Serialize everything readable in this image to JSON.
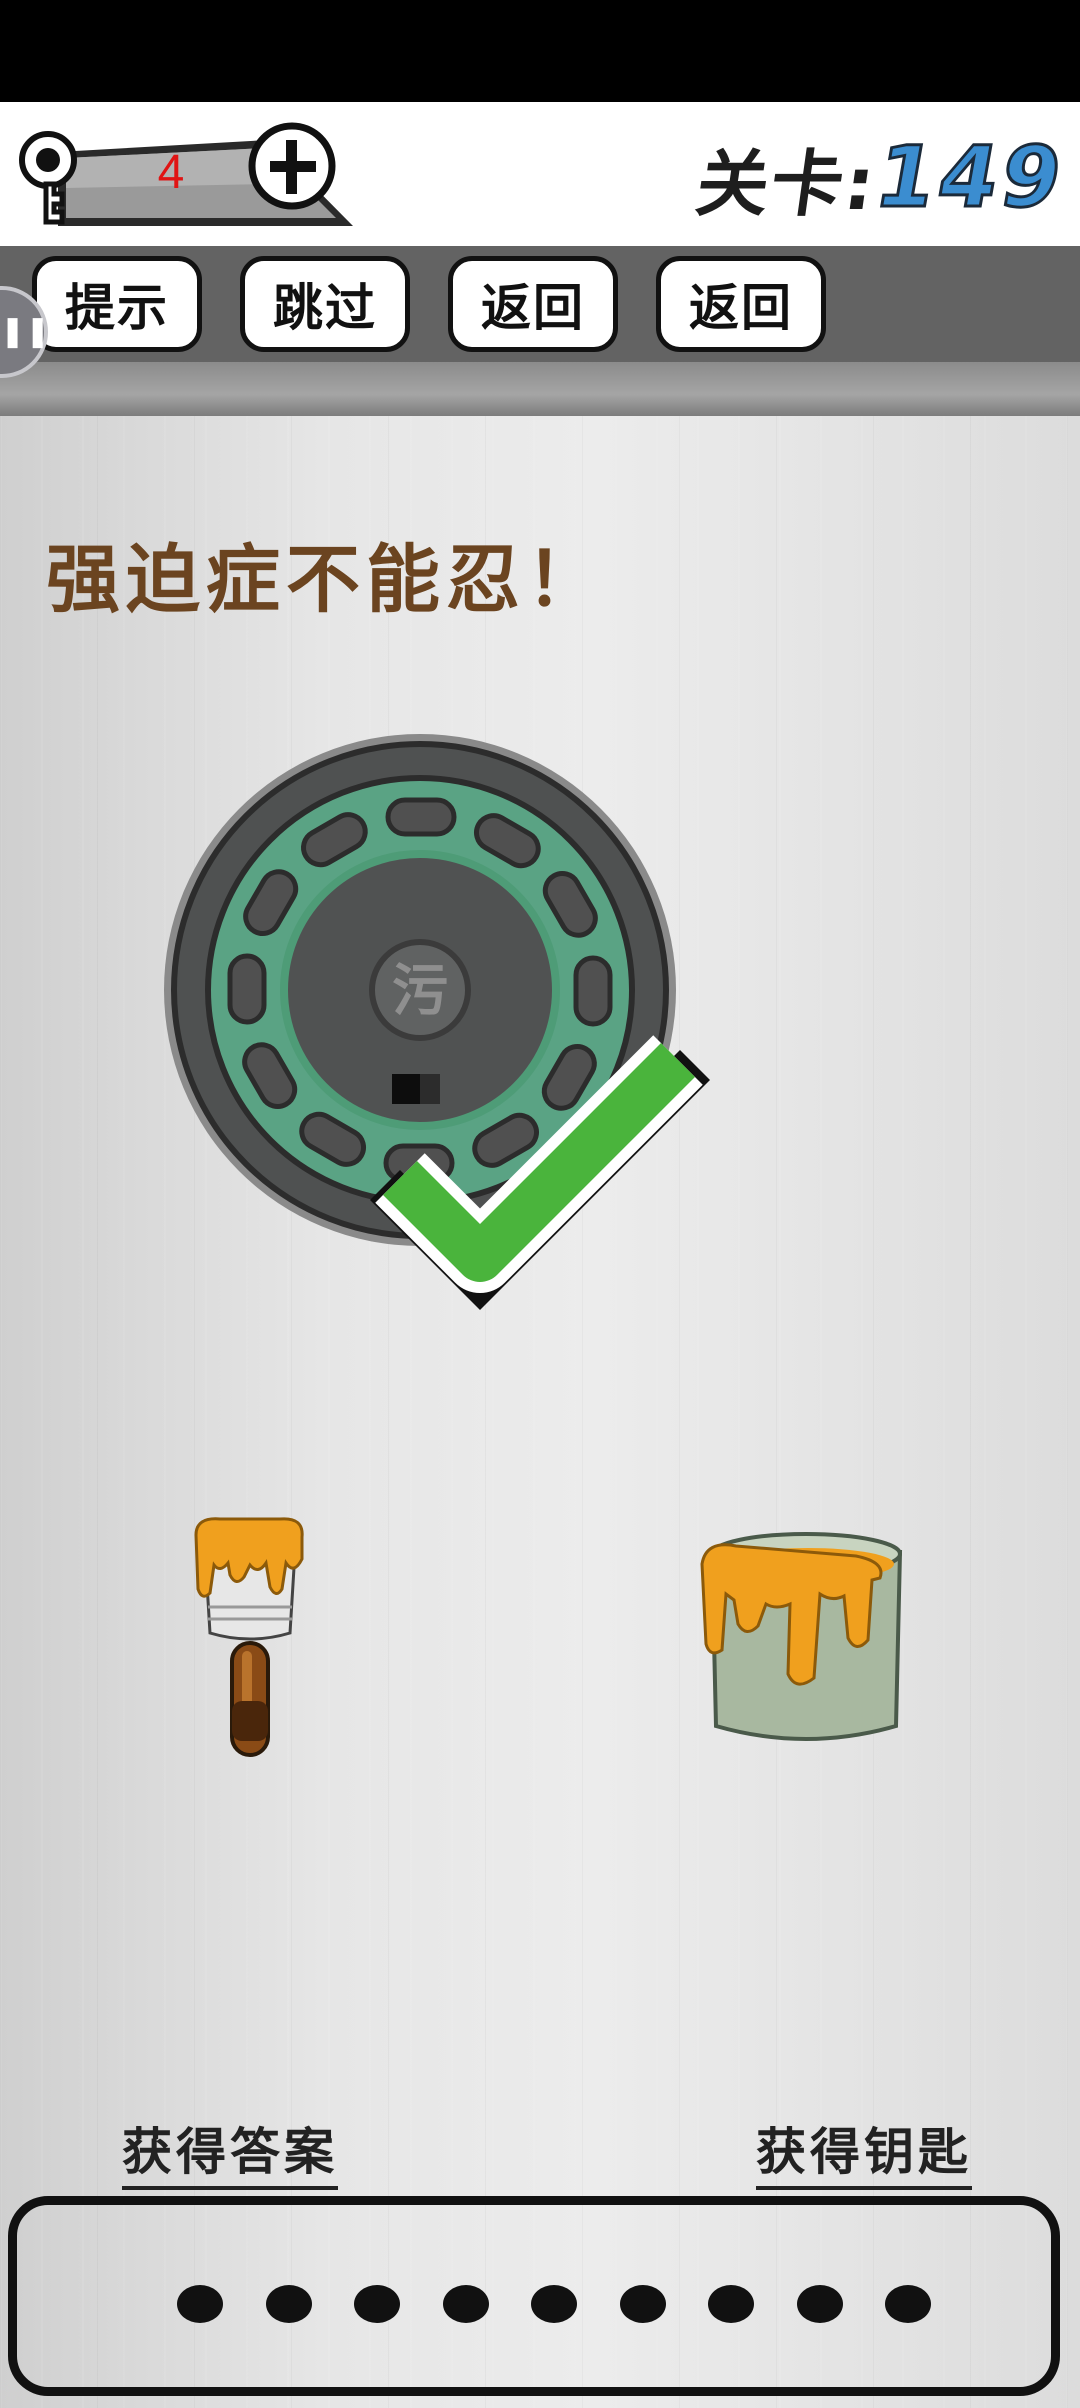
{
  "header": {
    "key_count": "4",
    "add_keys_symbol": "+",
    "level_label": "关卡:",
    "level_number": "149"
  },
  "toolbar": {
    "buttons": [
      "提示",
      "跳过",
      "返回",
      "返回"
    ]
  },
  "puzzle": {
    "title": "强迫症不能忍！",
    "lid_glyph": "污",
    "solved": true
  },
  "links": {
    "get_answer": "获得答案",
    "get_key": "获得钥匙"
  },
  "answer": {
    "slots": 9
  },
  "colors": {
    "level_number": "#3b8dd0",
    "key_count": "#e01414",
    "check_green": "#4ab43c",
    "paint": "#f0a01e",
    "cover_green": "#5aa384"
  }
}
